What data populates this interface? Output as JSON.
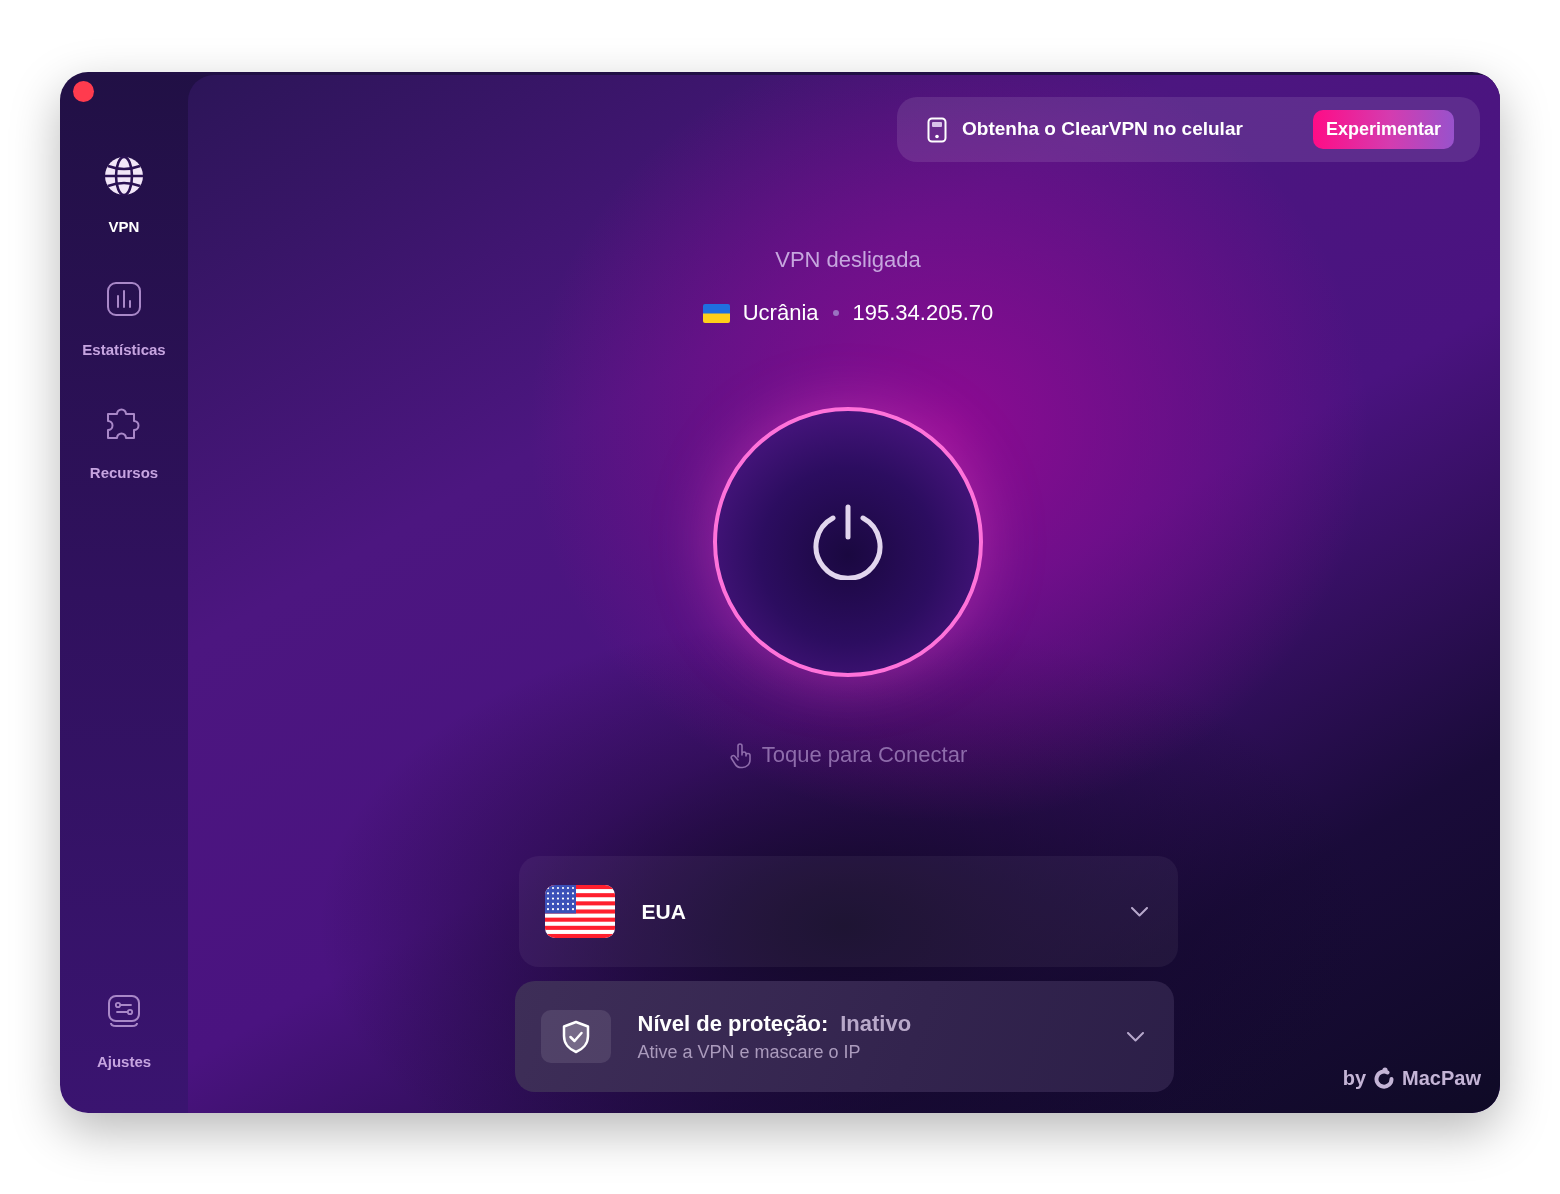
{
  "sidebar": {
    "items": [
      {
        "label": "VPN",
        "selected": true
      },
      {
        "label": "Estatísticas",
        "selected": false
      },
      {
        "label": "Recursos",
        "selected": false
      }
    ],
    "bottom_items": [
      {
        "label": "Ajustes",
        "selected": false
      }
    ]
  },
  "promo_banner": {
    "text": "Obtenha o ClearVPN no celular",
    "button": "Experimentar"
  },
  "status": {
    "title": "VPN desligada",
    "country": "Ucrânia",
    "ip": "195.34.205.70"
  },
  "connect_hint": "Toque para Conectar",
  "location_selector": {
    "country": "EUA"
  },
  "protection_card": {
    "label": "Nível de proteção:",
    "value": "Inativo",
    "description": "Ative a VPN e mascare o IP"
  },
  "footer": {
    "prefix": "by",
    "brand": "MacPaw"
  }
}
